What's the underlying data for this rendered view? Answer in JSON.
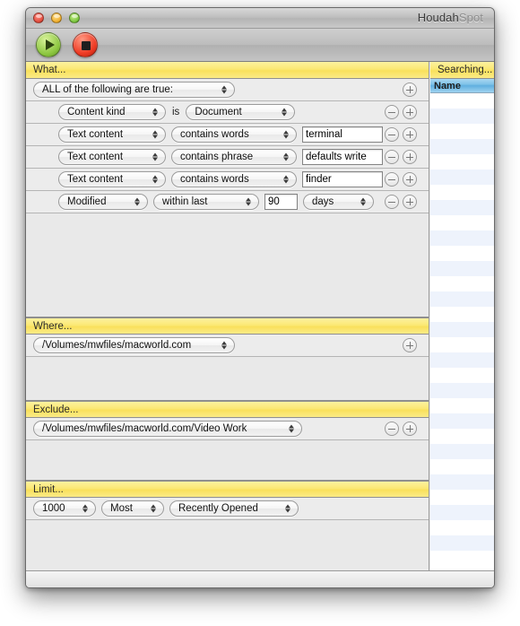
{
  "window": {
    "title_main": "Houdah",
    "title_dim": "Spot",
    "close_label": "close",
    "minimize_label": "minimize",
    "zoom_label": "zoom"
  },
  "toolbar": {
    "search_label": "Search",
    "stop_label": "Stop"
  },
  "sections": {
    "what": {
      "header": "What...",
      "boolean_row": {
        "popup": "ALL of the following are true:",
        "add": "+"
      },
      "criteria": [
        {
          "attribute": "Content kind",
          "mid_label": "is",
          "operator": null,
          "value_popup": "Document",
          "value_field": null,
          "unit": null,
          "remove": "−",
          "add": "+"
        },
        {
          "attribute": "Text content",
          "mid_label": null,
          "operator": "contains words",
          "value_popup": null,
          "value_field": "terminal",
          "unit": null,
          "remove": "−",
          "add": "+"
        },
        {
          "attribute": "Text content",
          "mid_label": null,
          "operator": "contains phrase",
          "value_popup": null,
          "value_field": "defaults write",
          "unit": null,
          "remove": "−",
          "add": "+"
        },
        {
          "attribute": "Text content",
          "mid_label": null,
          "operator": "contains words",
          "value_popup": null,
          "value_field": "finder",
          "unit": null,
          "remove": "−",
          "add": "+"
        },
        {
          "attribute": "Modified",
          "mid_label": null,
          "operator": "within last",
          "value_popup": null,
          "value_field": "90",
          "unit": "days",
          "remove": "−",
          "add": "+"
        }
      ]
    },
    "where": {
      "header": "Where...",
      "path": "/Volumes/mwfiles/macworld.com",
      "add": "+"
    },
    "exclude": {
      "header": "Exclude...",
      "path": "/Volumes/mwfiles/macworld.com/Video Work",
      "remove": "−",
      "add": "+"
    },
    "limit": {
      "header": "Limit...",
      "count": "1000",
      "order": "Most",
      "criterion": "Recently Opened"
    }
  },
  "results": {
    "status": "Searching...",
    "column_name": "Name",
    "row_count": 31
  },
  "colors": {
    "section_header_yellow": "#fbe873",
    "column_header_blue": "#7fc2e8",
    "row_stripe": "#eef3fc",
    "window_chrome": "#bdbdbd"
  }
}
